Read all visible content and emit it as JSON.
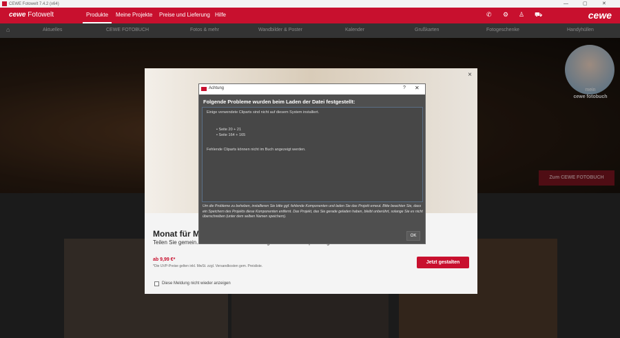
{
  "window": {
    "title": "CEWE Fotowelt 7.4.2 (x64)",
    "minimize": "—",
    "maximize": "▢",
    "close": "✕"
  },
  "header": {
    "logo_bold": "cewe",
    "logo_text": "Fotowelt",
    "tabs": [
      {
        "label": "Produkte",
        "active": true
      },
      {
        "label": "Meine Projekte",
        "active": false
      },
      {
        "label": "Preise und Lieferung",
        "active": false
      },
      {
        "label": "Hilfe",
        "active": false
      }
    ],
    "brand": "cewe",
    "icons": [
      "phone-icon",
      "gear-icon",
      "user-icon",
      "cart-icon"
    ]
  },
  "categories": [
    "Aktuelles",
    "CEWE FOTOBUCH",
    "Fotos & mehr",
    "Wandbilder & Poster",
    "Kalender",
    "Grußkarten",
    "Fotogeschenke",
    "Handyhüllen"
  ],
  "hero": {
    "mein_label": "mein",
    "fotobuch_label": "cewe fotobuch",
    "cta": "Zum CEWE FOTOBUCH"
  },
  "promo": {
    "title": "Monat für Mo",
    "desc": "Teilen Sie gemein… Auf Wunsch mit hochwertiger Geschenkverpackung.",
    "price": "ab 9,99 €*",
    "fine": "*Die UVP-Preise gelten inkl. MwSt. zzgl. Versandkosten gem. Preisliste.",
    "cta": "Jetzt gestalten",
    "checkbox_label": "Diese Meldung nicht wieder anzeigen",
    "close": "×"
  },
  "dialog": {
    "title": "Achtung",
    "help": "?",
    "close": "✕",
    "heading": "Folgende Probleme wurden beim Laden der Datei festgestellt:",
    "line1": "Einige verwendete Cliparts sind nicht auf diesem System installiert.",
    "items": [
      "• Seite 20 + 21",
      "• Seite 164 + 165"
    ],
    "line2": "Fehlende Cliparts können nicht im Buch angezeigt werden.",
    "footer": "Um die Probleme zu beheben, installieren Sie bitte ggf. fehlende Komponenten und laden Sie das Projekt erneut. Bitte beachten Sie, dass ein Speichern des Projekts diese Komponenten entfernt. Das Projekt, das Sie gerade geladen haben, bleibt unberührt, solange Sie es nicht überschreiben (unter dem selben Namen speichern).",
    "ok": "OK"
  }
}
